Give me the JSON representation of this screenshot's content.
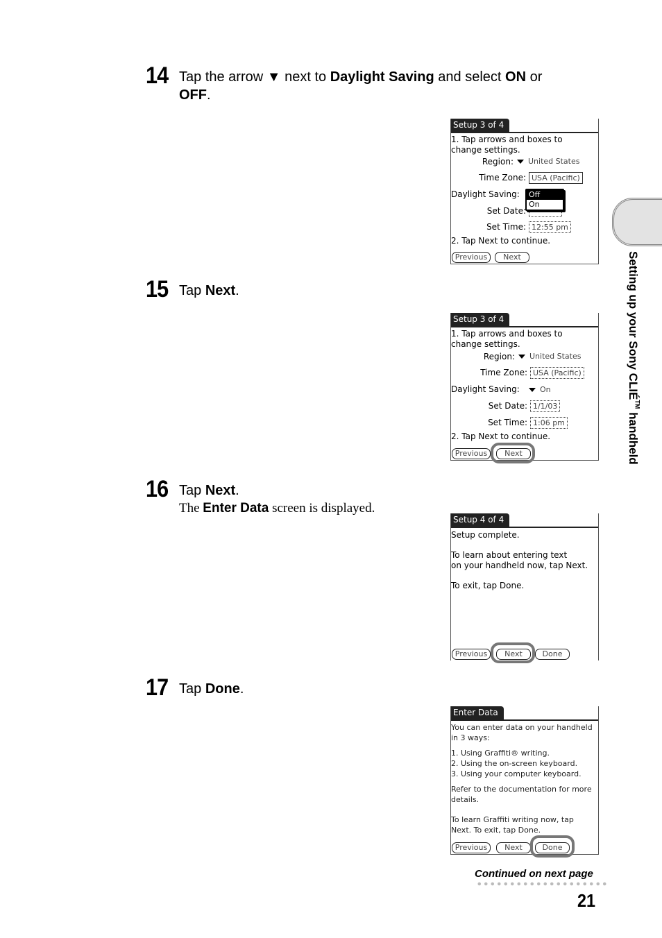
{
  "steps": [
    {
      "number": "14",
      "text_parts": [
        "Tap the arrow ",
        "▼",
        " next to ",
        "Daylight Saving",
        " and select ",
        "ON",
        " or"
      ],
      "line2_bold": "OFF",
      "line2_tail": "."
    },
    {
      "number": "15",
      "text_pre": "Tap ",
      "text_bold": "Next",
      "text_post": "."
    },
    {
      "number": "16",
      "text_pre": "Tap ",
      "text_bold": "Next",
      "text_post": ".",
      "sub_pre": "The ",
      "sub_bold": "Enter Data",
      "sub_post": " screen is displayed."
    },
    {
      "number": "17",
      "text_pre": "Tap ",
      "text_bold": "Done",
      "text_post": "."
    }
  ],
  "screens": {
    "s1": {
      "title": "Setup   3 of 4",
      "instr1_a": "1. Tap arrows and boxes to",
      "instr1_b": "change settings.",
      "region_label": "Region:",
      "region_value": "United States",
      "tz_label": "Time Zone:",
      "tz_value": "USA (Pacific)",
      "dst_label": "Daylight Saving:",
      "dst_options": [
        "Off",
        "On"
      ],
      "date_label": "Set Date:",
      "time_label": "Set Time:",
      "time_value": "12:55 pm",
      "instr2": "2. Tap Next to continue.",
      "btn_prev": "Previous",
      "btn_next": "Next"
    },
    "s2": {
      "title": "Setup   3 of 4",
      "instr1_a": "1. Tap arrows and boxes to",
      "instr1_b": "change settings.",
      "region_label": "Region:",
      "region_value": "United States",
      "tz_label": "Time Zone:",
      "tz_value": "USA (Pacific)",
      "dst_label": "Daylight Saving:",
      "dst_value": "On",
      "date_label": "Set Date:",
      "date_value": "1/1/03",
      "time_label": "Set Time:",
      "time_value": "1:06 pm",
      "instr2": "2. Tap Next to continue.",
      "btn_prev": "Previous",
      "btn_next": "Next"
    },
    "s3": {
      "title": "Setup   4 of 4",
      "line1": "Setup complete.",
      "line2": "To learn about entering text",
      "line3": "on your handheld now, tap Next.",
      "line4": "To exit, tap Done.",
      "btn_prev": "Previous",
      "btn_next": "Next",
      "btn_done": "Done"
    },
    "s4": {
      "title": "Enter Data",
      "line1": "You can enter data on your handheld",
      "line2": "in 3 ways:",
      "item1": "1. Using Graffiti® writing.",
      "item2": "2. Using the on-screen keyboard.",
      "item3": "3. Using your computer keyboard.",
      "line3": "Refer to the documentation for more",
      "line4": "details.",
      "line5": "To learn Graffiti writing now, tap",
      "line6": "Next. To exit, tap Done.",
      "btn_prev": "Previous",
      "btn_next": "Next",
      "btn_done": "Done"
    }
  },
  "sidebar": {
    "chapter_title": "Setting up your Sony CLIÉ",
    "tm": "TM",
    "chapter_tail": " handheld"
  },
  "footer": {
    "continued": "Continued on next page",
    "page_number": "21"
  }
}
